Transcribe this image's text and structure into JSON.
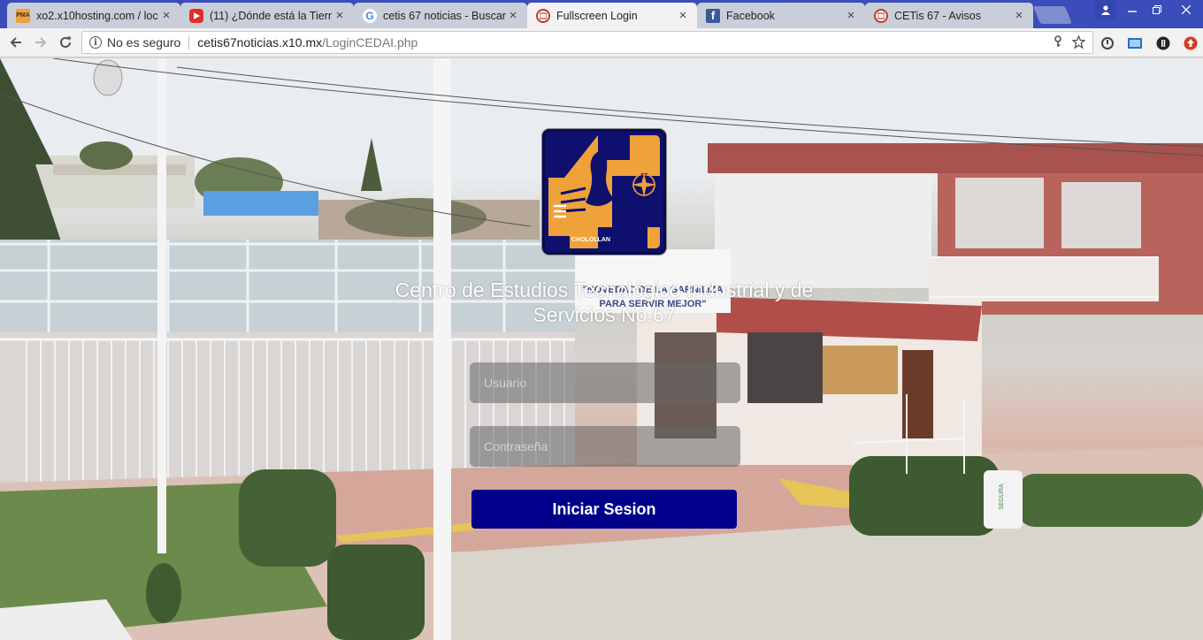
{
  "browser": {
    "tabs": [
      {
        "title": "xo2.x10hosting.com / loc",
        "favicon": "phpmyadmin-icon",
        "favicon_text": "PMA",
        "active": false
      },
      {
        "title": "(11) ¿Dónde está la Tierr",
        "favicon": "youtube-icon",
        "active": false
      },
      {
        "title": "cetis 67 noticias - Buscar",
        "favicon": "google-icon",
        "favicon_text": "G",
        "active": false
      },
      {
        "title": "Fullscreen Login",
        "favicon": "page-icon",
        "active": true
      },
      {
        "title": "Facebook",
        "favicon": "facebook-icon",
        "favicon_text": "f",
        "active": false
      },
      {
        "title": "CETis 67 - Avisos",
        "favicon": "page-icon",
        "active": false
      }
    ],
    "address": {
      "security_label": "No es seguro",
      "host": "cetis67noticias.x10.mx",
      "path": "/LoginCEDAI.php"
    }
  },
  "login": {
    "logo_text": "CHOLOLLAN",
    "logo_badge": "67",
    "school_name": "Centro de Estudios Tecnológico Industrial y de Servicios No.67",
    "username_placeholder": "Usuario",
    "password_placeholder": "Contraseña",
    "submit_label": "Iniciar Sesion"
  },
  "scene": {
    "sign_line1": "\"NOVEDAD DE LA GARNILIZA",
    "sign_line2": "PARA SERVIR MEJOR\"",
    "bin_label": "SEGURA"
  },
  "colors": {
    "tab_strip": "#3a4dba",
    "button": "#00008b",
    "logo_orange": "#f0a23a",
    "logo_navy": "#0f0f6e"
  }
}
